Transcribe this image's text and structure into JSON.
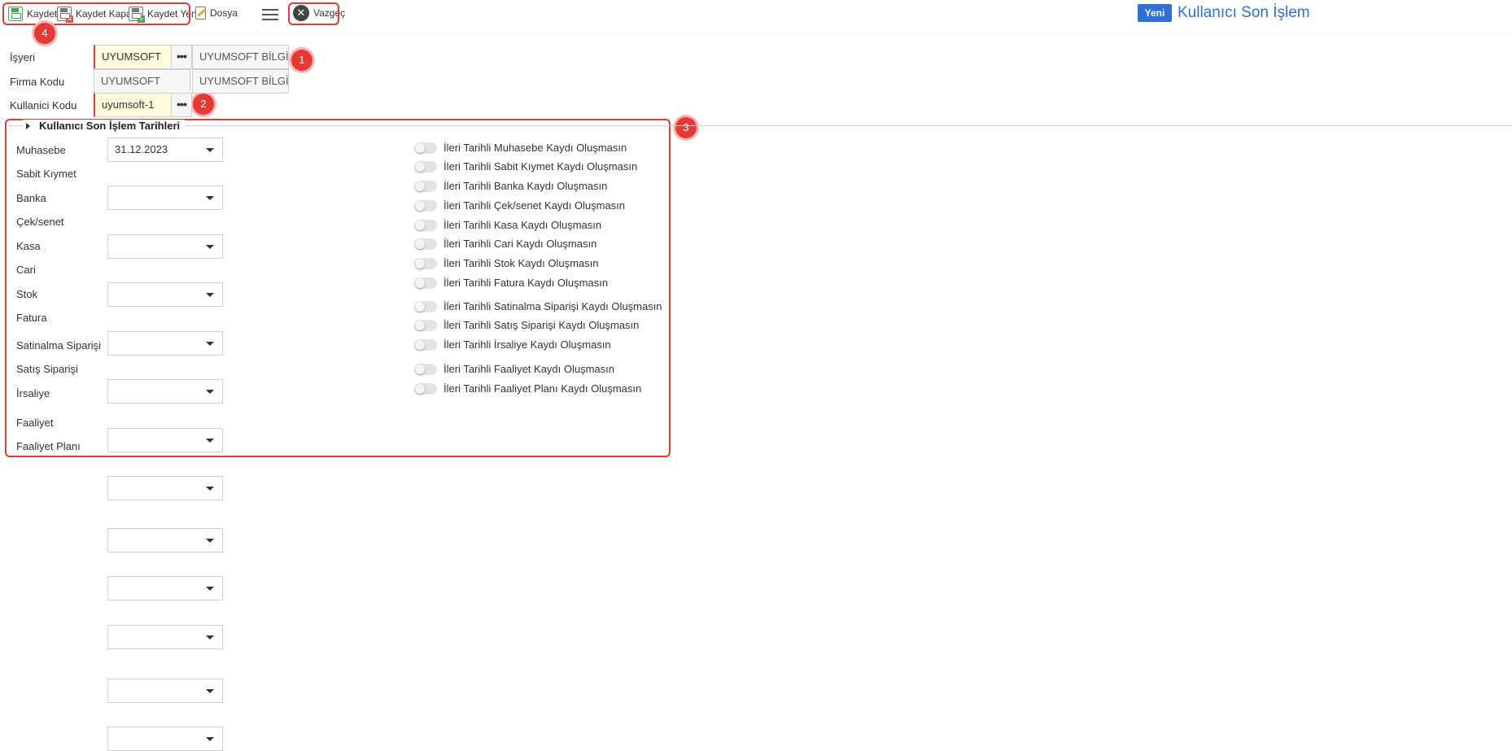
{
  "toolbar": {
    "save_label": "Kaydet",
    "save_close_label": "Kaydet Kapat",
    "save_new_label": "Kaydet Yeni",
    "file_label": "Dosya",
    "cancel_label": "Vazgeç"
  },
  "header": {
    "new_label": "Yeni",
    "title": "Kullanıcı Son İşlem"
  },
  "form": {
    "workplace_label": "İşyeri",
    "workplace_code": "UYUMSOFT",
    "workplace_name": "UYUMSOFT BİLGİ SİSTE",
    "company_label": "Firma Kodu",
    "company_code": "UYUMSOFT",
    "company_name": "UYUMSOFT BİLGİ SİSTE",
    "user_label": "Kullanici Kodu",
    "user_code": "uyumsoft-1"
  },
  "section": {
    "title": "Kullanıcı Son İşlem Tarihleri",
    "date_fields": [
      {
        "label": "Muhasebe",
        "value": "31.12.2023"
      },
      {
        "label": "Sabit Kıymet",
        "value": ""
      },
      {
        "label": "Banka",
        "value": ""
      },
      {
        "label": "Çek/senet",
        "value": ""
      },
      {
        "label": "Kasa",
        "value": ""
      },
      {
        "label": "Cari",
        "value": ""
      },
      {
        "label": "Stok",
        "value": ""
      },
      {
        "label": "Fatura",
        "value": ""
      },
      {
        "label": "Satinalma Siparişi",
        "value": ""
      },
      {
        "label": "Satış Siparişi",
        "value": ""
      },
      {
        "label": "İrsaliye",
        "value": ""
      },
      {
        "label": "Faaliyet",
        "value": ""
      },
      {
        "label": "Faaliyet Planı",
        "value": ""
      }
    ],
    "toggles": [
      {
        "label": "İleri Tarihli Muhasebe Kaydı Oluşmasın",
        "on": false
      },
      {
        "label": "İleri Tarihli Sabit Kıymet Kaydı Oluşmasın",
        "on": false
      },
      {
        "label": "İleri Tarihli Banka Kaydı Oluşmasın",
        "on": false
      },
      {
        "label": "İleri Tarihli Çek/senet Kaydı Oluşmasın",
        "on": false
      },
      {
        "label": "İleri Tarihli Kasa Kaydı Oluşmasın",
        "on": false
      },
      {
        "label": "İleri Tarihli Cari Kaydı Oluşmasın",
        "on": false
      },
      {
        "label": "İleri Tarihli Stok Kaydı Oluşmasın",
        "on": false
      },
      {
        "label": "İleri Tarihli Fatura Kaydı Oluşmasın",
        "on": false
      },
      {
        "label": "İleri Tarihli Satinalma Siparişi Kaydı Oluşmasın",
        "on": false
      },
      {
        "label": "İleri Tarihli Satış Siparişi Kaydı Oluşmasın",
        "on": false
      },
      {
        "label": "İleri Tarihli İrsaliye Kaydı Oluşmasın",
        "on": false
      },
      {
        "label": "İleri Tarihli Faaliyet Kaydı Oluşmasın",
        "on": false
      },
      {
        "label": "İleri Tarihli Faaliyet Planı Kaydı Oluşmasın",
        "on": false
      }
    ]
  },
  "annotations": {
    "marker_1": "1",
    "marker_2": "2",
    "marker_3": "3",
    "marker_4": "4"
  },
  "colors": {
    "accent": "#2f6fd8",
    "annotation_red": "#e53935",
    "required_bg": "#fffbdc"
  }
}
